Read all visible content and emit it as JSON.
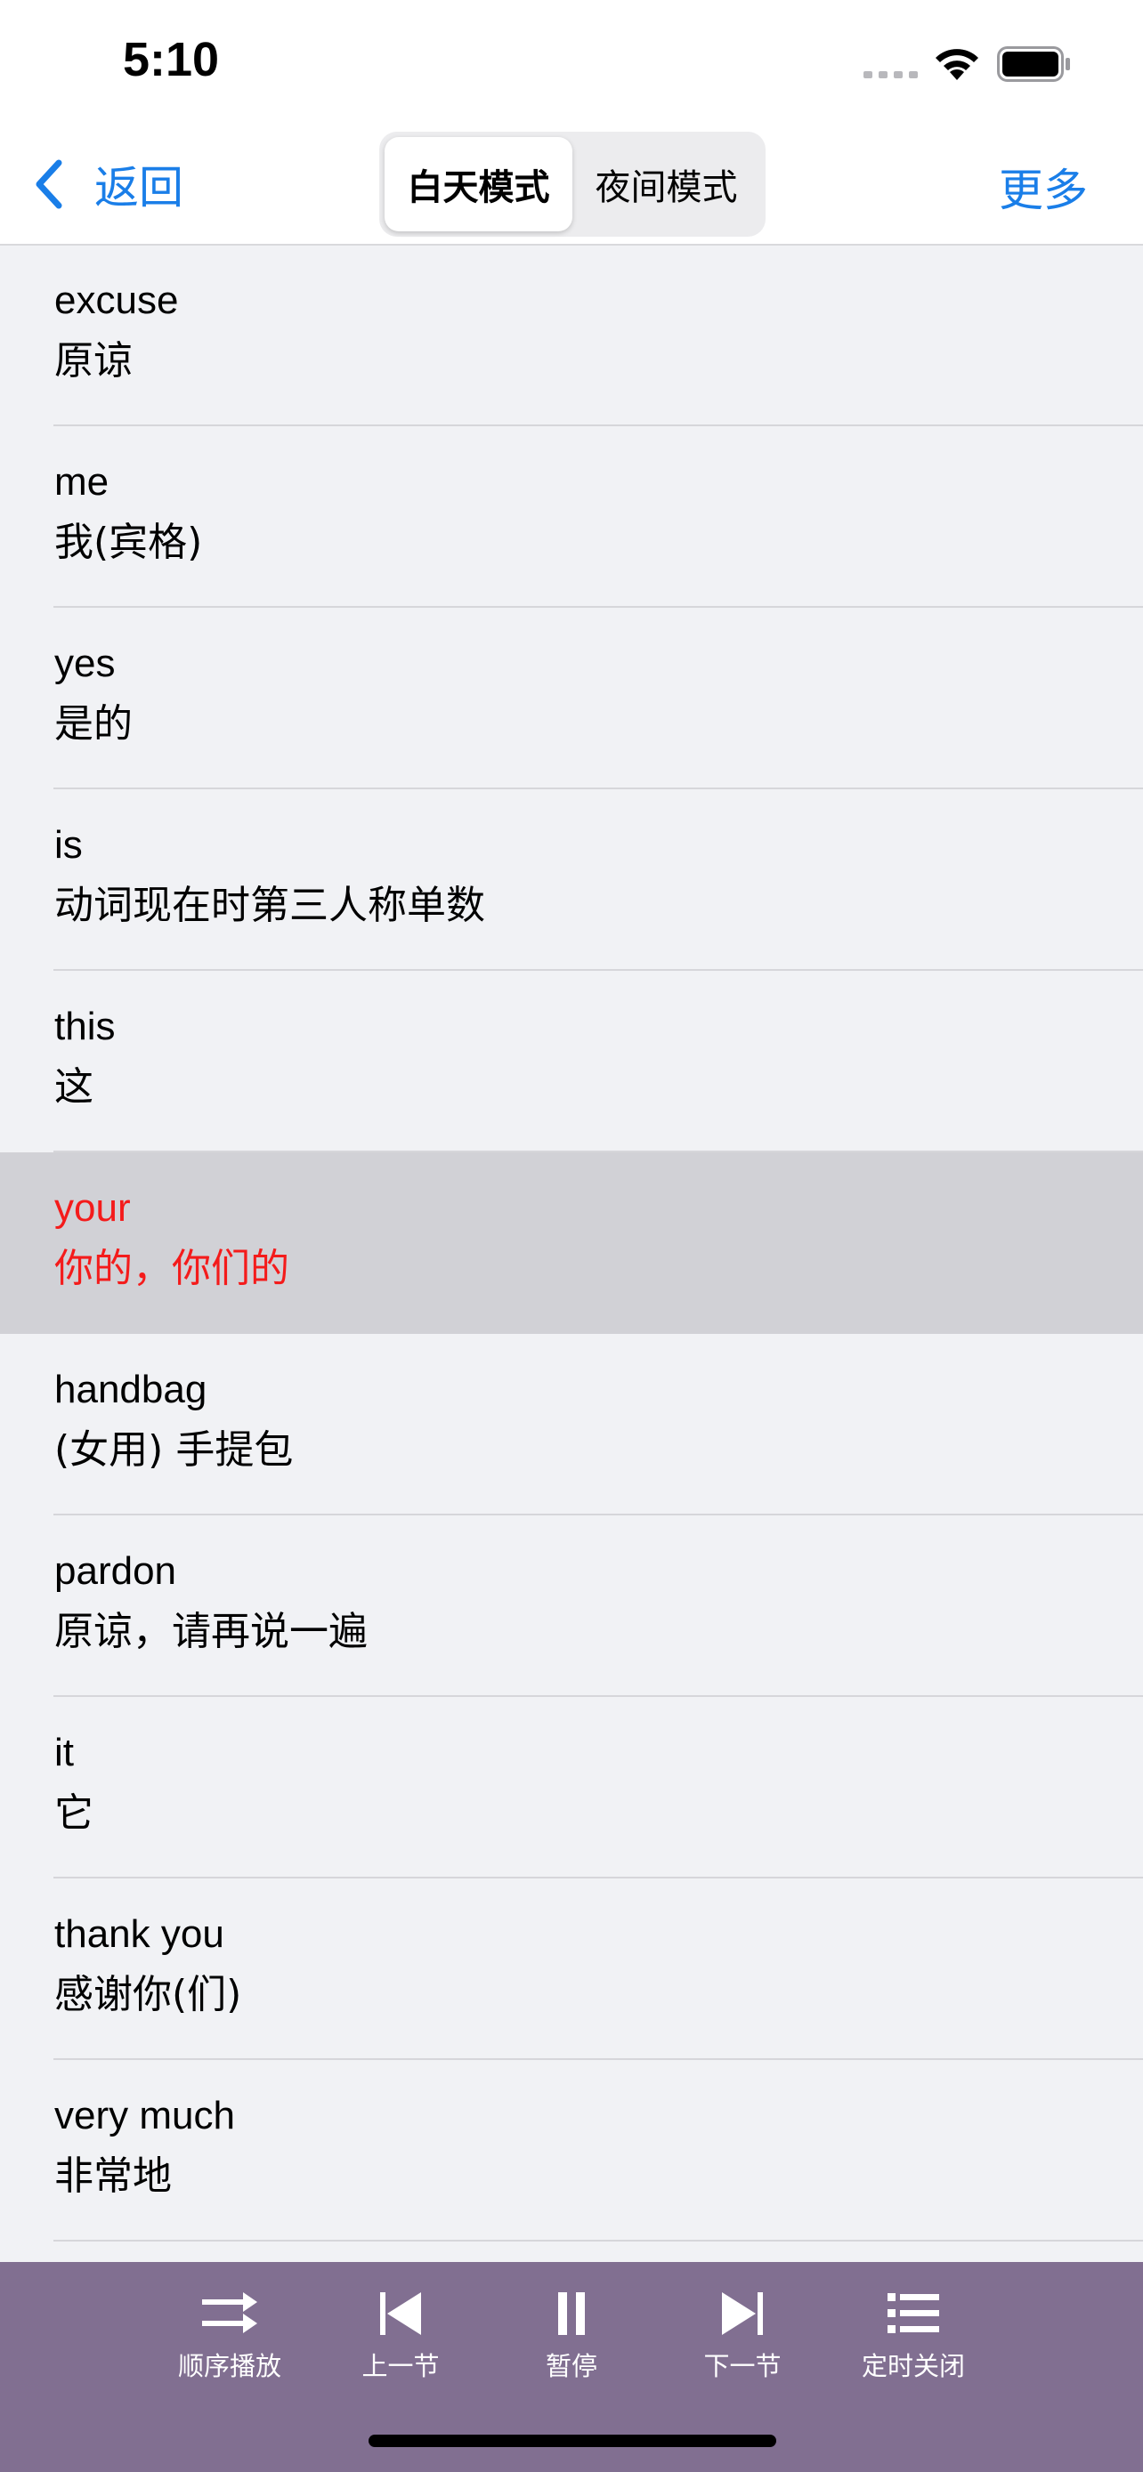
{
  "status_bar": {
    "time": "5:10",
    "icons": [
      "cellular-signal-icon",
      "wifi-icon",
      "battery-icon"
    ]
  },
  "nav": {
    "back_label": "返回",
    "segments": [
      {
        "label": "白天模式",
        "active": true
      },
      {
        "label": "夜间模式",
        "active": false
      }
    ],
    "more_label": "更多"
  },
  "words": [
    {
      "en": "excuse",
      "cn": "原谅"
    },
    {
      "en": "me",
      "cn": "我(宾格)"
    },
    {
      "en": "yes",
      "cn": "是的"
    },
    {
      "en": "is",
      "cn": "动词现在时第三人称单数"
    },
    {
      "en": "this",
      "cn": "这"
    },
    {
      "en": "your",
      "cn": "你的，你们的",
      "selected": true
    },
    {
      "en": "handbag",
      "cn": "(女用) 手提包"
    },
    {
      "en": "pardon",
      "cn": "原谅，请再说一遍"
    },
    {
      "en": "it",
      "cn": "它"
    },
    {
      "en": "thank you",
      "cn": "感谢你(们)"
    },
    {
      "en": "very much",
      "cn": "非常地"
    }
  ],
  "player": {
    "buttons": [
      {
        "label": "顺序播放",
        "icon": "sequential-play-icon"
      },
      {
        "label": "上一节",
        "icon": "previous-track-icon"
      },
      {
        "label": "暂停",
        "icon": "pause-icon"
      },
      {
        "label": "下一节",
        "icon": "next-track-icon"
      },
      {
        "label": "定时关闭",
        "icon": "timer-list-icon"
      }
    ]
  },
  "colors": {
    "accent": "#1a7ee8",
    "selected_text": "#f41b1b",
    "selected_row": "#d1d1d6",
    "player_bar": "#816f91",
    "list_bg": "#f1f2f5"
  }
}
